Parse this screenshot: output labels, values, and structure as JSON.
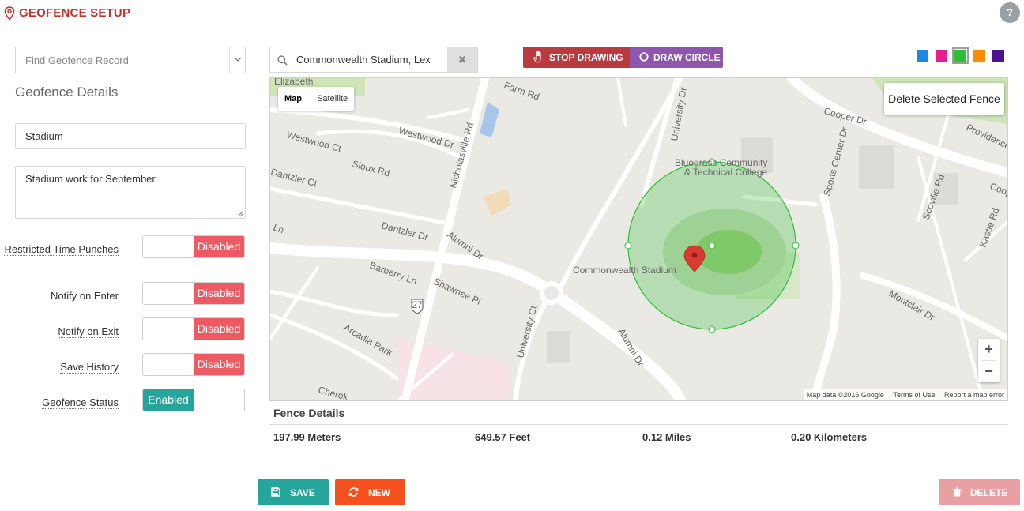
{
  "header": {
    "title": "GEOFENCE SETUP",
    "help_label": "?"
  },
  "sidebar": {
    "find_placeholder": "Find Geofence Record",
    "section_title": "Geofence Details",
    "name_value": "Stadium",
    "description_value": "Stadium work for September",
    "toggles": [
      {
        "label": "Restricted Time Punches",
        "state": "Disabled"
      },
      {
        "label": "Notify on Enter",
        "state": "Disabled"
      },
      {
        "label": "Notify on Exit",
        "state": "Disabled"
      },
      {
        "label": "Save History",
        "state": "Disabled"
      },
      {
        "label": "Geofence Status",
        "state": "Enabled"
      }
    ]
  },
  "toolbar": {
    "search_value": "Commonwealth Stadium, Lex",
    "clear_label": "✖",
    "stop_drawing_label": "STOP DRAWING",
    "draw_circle_label": "DRAW CIRCLE",
    "colors": [
      "#1e88e5",
      "#e91e8c",
      "#2ebd36",
      "#fb8c00",
      "#4a148c"
    ],
    "selected_color": "#2ebd36"
  },
  "map": {
    "type_map": "Map",
    "type_satellite": "Satellite",
    "delete_fence_label": "Delete Selected Fence",
    "zoom_in": "+",
    "zoom_out": "−",
    "footer_data": "Map data ©2016 Google",
    "footer_terms": "Terms of Use",
    "footer_report": "Report a map error",
    "labels": {
      "farm": "Farm Rd",
      "elizabeth": "Elizabeth",
      "westwood_dr": "Westwood Dr",
      "westwood_ct": "Westwood Ct",
      "sioux": "Sioux Rd",
      "dantzler_ct": "Dantzler Ct",
      "nicholasville": "Nicholasville Rd",
      "university_dr_top": "University Dr",
      "bluegrass_1": "Bluegrass Community",
      "bluegrass_2": "& Technical College",
      "cooper": "Cooper Dr",
      "providence": "Providence",
      "sports_center": "Sports Center Dr",
      "scoville": "Scoville Rd",
      "kastle": "Kastle Rd",
      "cooper_right": "Coop",
      "dantzler_dr": "Dantzler Dr",
      "alumni_dr": "Alumni Dr",
      "ln": "Ln",
      "barberry": "Barberry Ln",
      "shawnee": "Shawnee Pl",
      "stadium": "Commonwealth Stadium",
      "university_ct": "University Ct",
      "alumni_dr_lower": "Alumni Dr",
      "montclair": "Montclair Dr",
      "arcadia": "Arcadia Park",
      "cherokee": "Cherok",
      "route": "27"
    }
  },
  "fence_details": {
    "title": "Fence Details",
    "meters": "197.99 Meters",
    "feet": "649.57 Feet",
    "miles": "0.12 Miles",
    "kilometers": "0.20 Kilometers"
  },
  "actions": {
    "save_label": "SAVE",
    "new_label": "NEW",
    "delete_label": "DELETE"
  }
}
